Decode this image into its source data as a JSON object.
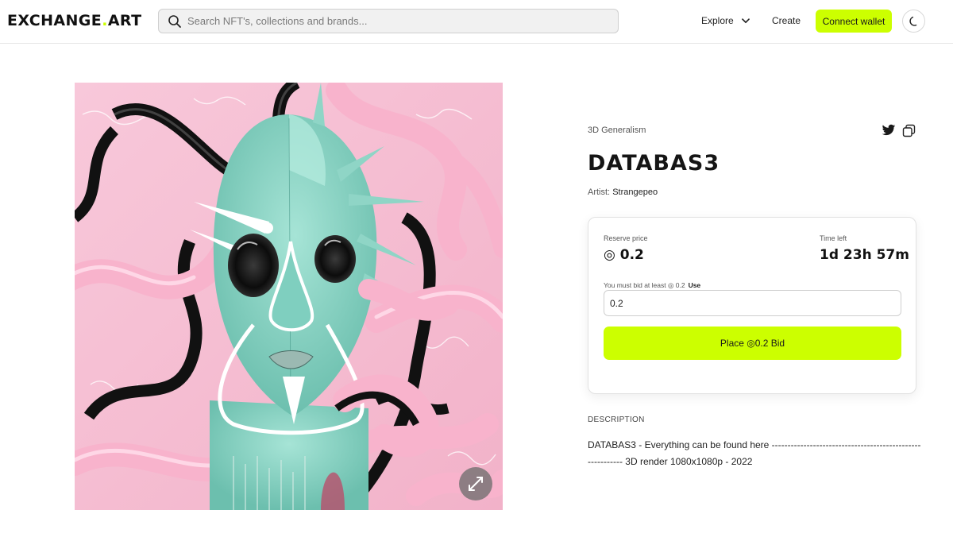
{
  "header": {
    "logo": {
      "prefix": "EXCHANGE",
      "dot": ".",
      "suffix": "ART"
    },
    "search": {
      "placeholder": "Search NFT's, collections and brands..."
    },
    "nav": {
      "explore": "Explore",
      "create": "Create"
    },
    "connect_wallet": "Connect wallet",
    "icons": {
      "search": "search-icon",
      "chevron": "chevron-down-icon",
      "theme": "moon-icon"
    }
  },
  "artwork": {
    "expand_icon": "expand-icon"
  },
  "details": {
    "category": "3D Generalism",
    "title": "DATABAS3",
    "artist_label": "Artist:",
    "artist_name": "Strangepeo",
    "share_icons": [
      "twitter-icon",
      "copy-icon"
    ]
  },
  "bid": {
    "reserve_label": "Reserve price",
    "reserve_value": "◎ 0.2",
    "time_label": "Time left",
    "time_value": "1d 23h 57m",
    "min_bid_text": "You must bid at least ◎ 0.2",
    "use_label": "Use",
    "input_value": "0.2",
    "place_button": "Place ◎0.2 Bid"
  },
  "description": {
    "heading": "DESCRIPTION",
    "text": "DATABAS3 - Everything can be found here ---------------------------------------------------------- 3D render 1080x1080p - 2022"
  },
  "colors": {
    "accent": "#ccff00",
    "artwork_pink": "#f6bfd3",
    "artwork_teal": "#8fd5c6"
  }
}
